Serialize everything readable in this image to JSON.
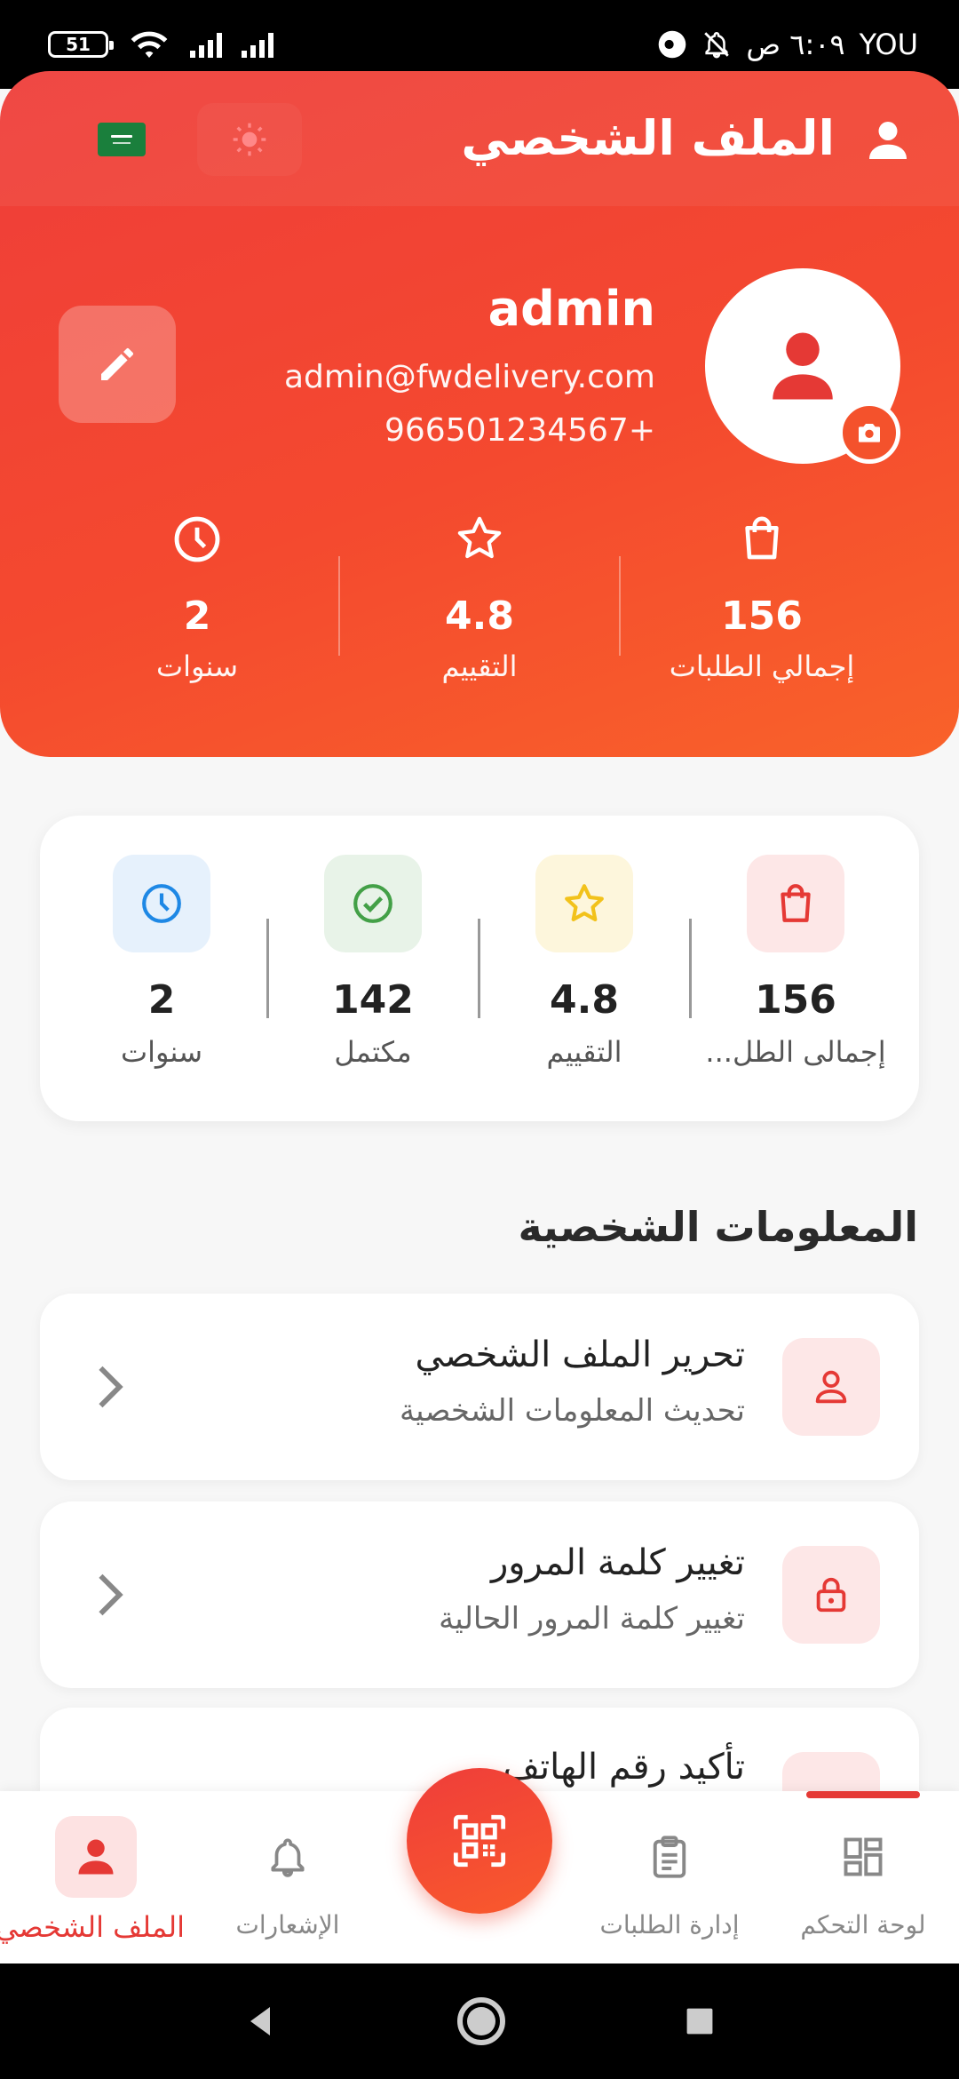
{
  "status_bar": {
    "battery": "51",
    "time": "٦:٠٩ ص",
    "carrier": "YOU"
  },
  "header": {
    "title": "الملف الشخصي",
    "icons": [
      "user-icon",
      "sun-icon",
      "saudi-flag-icon"
    ]
  },
  "profile": {
    "name": "admin",
    "email": "admin@fwdelivery.com",
    "phone": "966501234567+"
  },
  "hero_stats": [
    {
      "icon": "shopping-bag-icon",
      "value": "156",
      "label": "إجمالي الطلبات"
    },
    {
      "icon": "star-icon",
      "value": "4.8",
      "label": "التقييم"
    },
    {
      "icon": "clock-icon",
      "value": "2",
      "label": "سنوات"
    }
  ],
  "stats_card": [
    {
      "icon": "shopping-bag-icon",
      "value": "156",
      "label": "إجمالى الطل...",
      "color": "#e53935",
      "bg": "#fde7e7"
    },
    {
      "icon": "star-icon",
      "value": "4.8",
      "label": "التقييم",
      "color": "#f2c21b",
      "bg": "#fdf6dc"
    },
    {
      "icon": "check-circle-icon",
      "value": "142",
      "label": "مكتمل",
      "color": "#43a047",
      "bg": "#e8f3e8"
    },
    {
      "icon": "clock-icon",
      "value": "2",
      "label": "سنوات",
      "color": "#1e88e5",
      "bg": "#e6f1fc"
    }
  ],
  "section": {
    "title": "المعلومات الشخصية"
  },
  "menu": [
    {
      "icon": "user-icon",
      "title": "تحرير الملف الشخصي",
      "subtitle": "تحديث المعلومات الشخصية"
    },
    {
      "icon": "lock-icon",
      "title": "تغيير كلمة المرور",
      "subtitle": "تغيير كلمة المرور الحالية"
    },
    {
      "icon": "phone-icon",
      "title": "تأكيد رقم الهاتف",
      "subtitle": ""
    }
  ],
  "bottom_nav": [
    {
      "icon": "dashboard-icon",
      "label": "لوحة التحكم"
    },
    {
      "icon": "clipboard-icon",
      "label": "إدارة الطلبات"
    },
    {
      "icon": "qr-scan-icon",
      "label": ""
    },
    {
      "icon": "bell-icon",
      "label": "الإشعارات"
    },
    {
      "icon": "user-icon",
      "label": "الملف الشخصي",
      "active": true
    }
  ],
  "colors": {
    "accent": "#e53935",
    "hero_start": "#ef3d3a",
    "hero_end": "#f9622a"
  }
}
